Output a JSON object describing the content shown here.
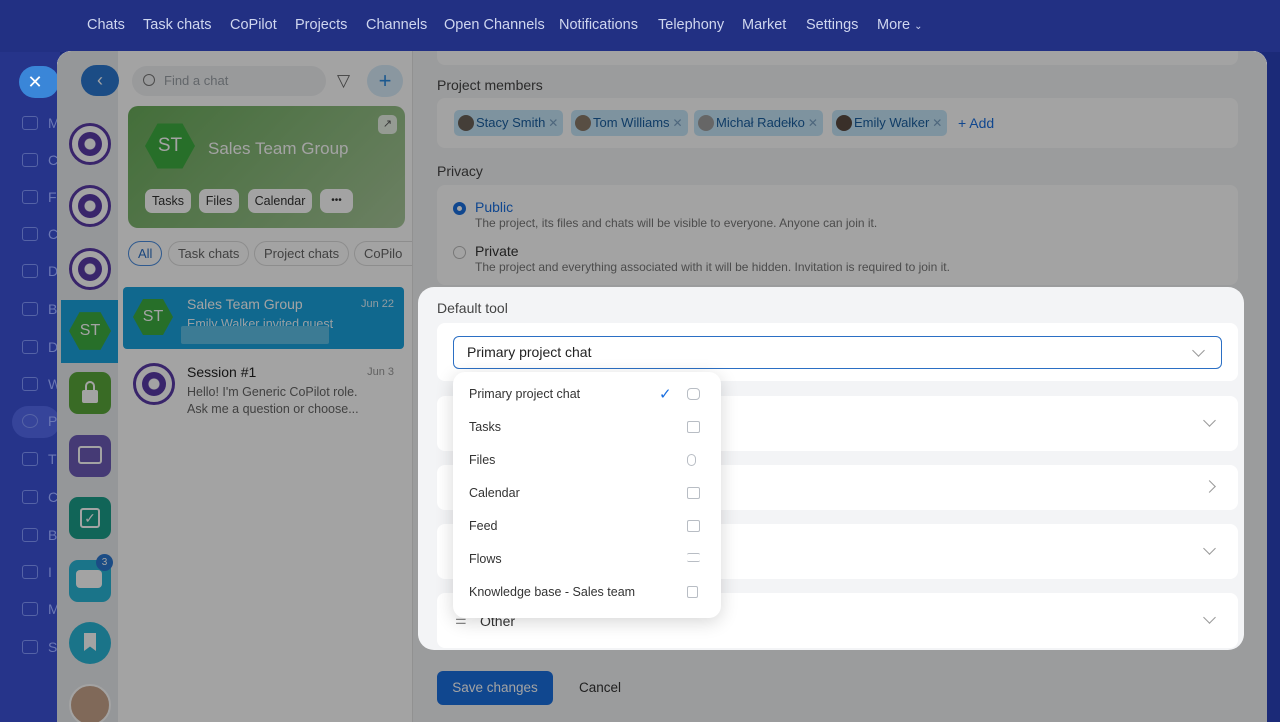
{
  "topnav": [
    "Chats",
    "Task chats",
    "CoPilot",
    "Projects",
    "Channels",
    "Open Channels",
    "Notifications",
    "Telephony",
    "Market",
    "Settings",
    "More"
  ],
  "left_sidebar_items": [
    "M",
    "C",
    "F",
    "C",
    "D",
    "B",
    "D",
    "W",
    "P",
    "T",
    "C",
    "B",
    "I",
    "M",
    "S"
  ],
  "chat_list": {
    "search_placeholder": "Find a chat",
    "group_card": {
      "initials": "ST",
      "title": "Sales Team Group",
      "buttons": [
        "Tasks",
        "Files",
        "Calendar",
        "•••"
      ]
    },
    "filters": [
      "All",
      "Task chats",
      "Project chats",
      "CoPilo"
    ],
    "chats": [
      {
        "title": "Sales Team Group",
        "date": "Jun 22",
        "preview": "Emily Walker invited guest",
        "initials": "ST"
      },
      {
        "title": "Session #1",
        "date": "Jun 3",
        "preview": "Hello! I'm Generic CoPilot role. Ask me a question or choose..."
      }
    ],
    "rail_badge": "3"
  },
  "form": {
    "members_label": "Project members",
    "members": [
      "Stacy Smith",
      "Tom Williams",
      "Michał Radełko",
      "Emily Walker"
    ],
    "add_label": "+ Add",
    "privacy_label": "Privacy",
    "privacy_options": [
      {
        "title": "Public",
        "desc": "The project, its files and chats will be visible to everyone. Anyone can join it."
      },
      {
        "title": "Private",
        "desc": "The project and everything associated with it will be hidden. Invitation is required to join it."
      }
    ],
    "default_tool_label": "Default tool",
    "default_tool_value": "Primary project chat",
    "other_label": "Other",
    "save_label": "Save changes",
    "cancel_label": "Cancel"
  },
  "dropdown": {
    "items": [
      "Primary project chat",
      "Tasks",
      "Files",
      "Calendar",
      "Feed",
      "Flows",
      "Knowledge base - Sales team"
    ],
    "selected": "Primary project chat"
  },
  "colors": {
    "accent": "#1a6fe0",
    "highlight_chat": "#1aa3de",
    "group_green": "#3eae40"
  }
}
